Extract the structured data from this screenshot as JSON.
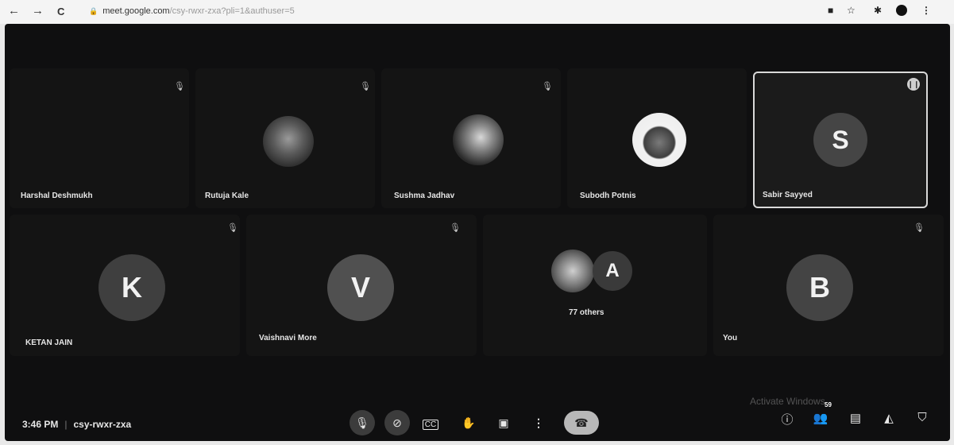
{
  "browser": {
    "back_icon": "←",
    "forward_icon": "→",
    "reload_icon": "C",
    "url_domain": "meet.google.com",
    "url_rest": "/csy-rwxr-zxa?pli=1&authuser=5"
  },
  "participants": {
    "harshal": {
      "name": "Harshal Deshmukh"
    },
    "rutuja": {
      "name": "Rutuja Kale"
    },
    "sushma": {
      "name": "Sushma Jadhav"
    },
    "subodh": {
      "name": "Subodh Potnis"
    },
    "sabir": {
      "name": "Sabir Sayyed",
      "initial": "S"
    },
    "ketan": {
      "name": "KETAN JAIN",
      "initial": "K"
    },
    "vaishnavi": {
      "name": "Vaishnavi More",
      "initial": "V"
    },
    "others": {
      "label": "77 others",
      "initial": "A"
    },
    "you": {
      "name": "You",
      "initial": "B"
    }
  },
  "meeting": {
    "time": "3:46 PM",
    "code": "csy-rwxr-zxa"
  },
  "watermark": "Activate Windows",
  "people_count": "59",
  "colors": {
    "letter_avatar_bg": "#4a4a4a",
    "active_border": "#d9d9d9",
    "meet_bg": "#0f0f10"
  }
}
